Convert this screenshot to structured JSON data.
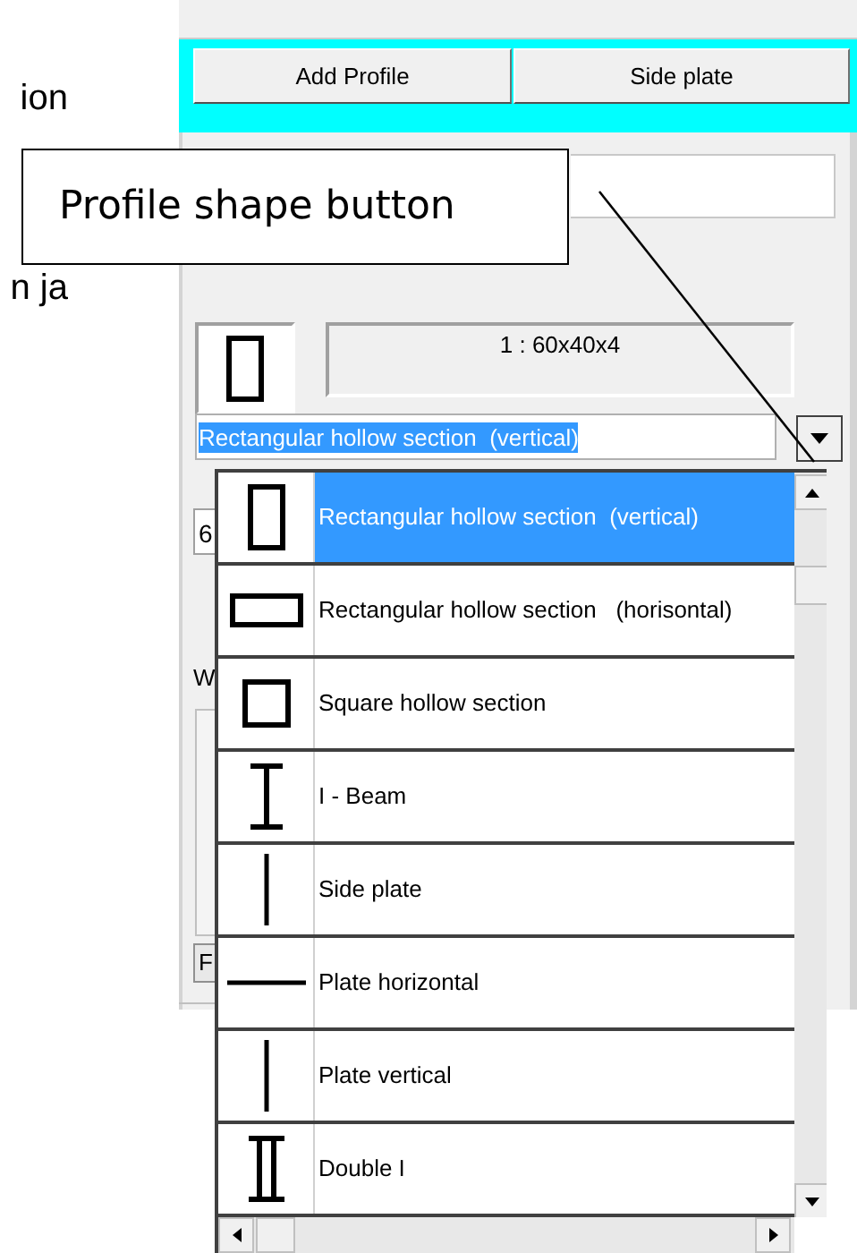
{
  "document_text": [
    "ion",
    "n ja"
  ],
  "toolbar": [
    "Add Profile",
    "Side plate"
  ],
  "callout": {
    "text": "Profile shape button"
  },
  "profile": {
    "label": "1 : 60x40x4",
    "combo_value": "Rectangular hollow section  (vertical)"
  },
  "covered_fields": [
    "6",
    "W",
    "F"
  ],
  "dropdown": {
    "items": [
      {
        "label": "Rectangular hollow section  (vertical)",
        "kind": "rect_v",
        "selected": true
      },
      {
        "label": "Rectangular hollow section   (horisontal)",
        "kind": "rect_h",
        "selected": false
      },
      {
        "label": "Square hollow section",
        "kind": "square",
        "selected": false
      },
      {
        "label": "I - Beam",
        "kind": "ibeam",
        "selected": false
      },
      {
        "label": "Side plate",
        "kind": "plate_v",
        "selected": false
      },
      {
        "label": "Plate horizontal",
        "kind": "plate_h",
        "selected": false
      },
      {
        "label": "Plate vertical",
        "kind": "plate_v",
        "selected": false
      },
      {
        "label": "Double I",
        "kind": "double_i",
        "selected": false
      }
    ]
  }
}
